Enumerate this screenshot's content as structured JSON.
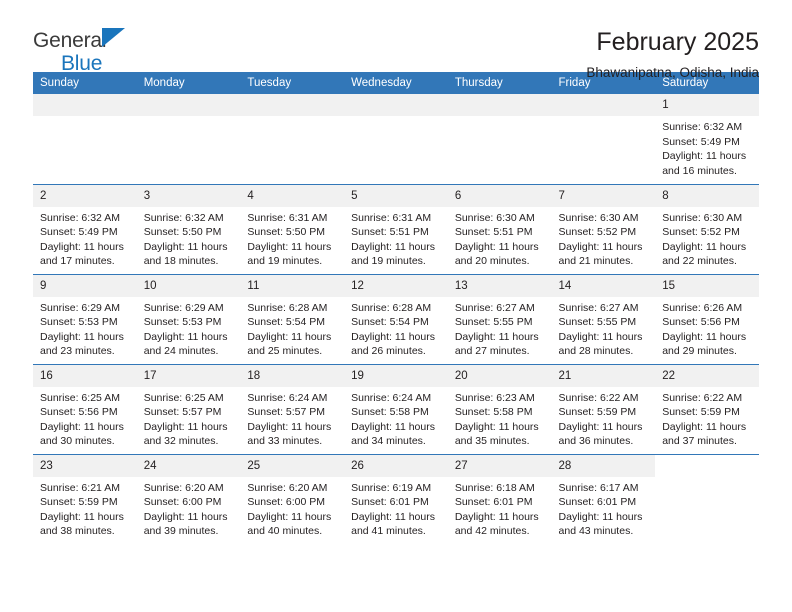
{
  "brand": {
    "line1": "General",
    "line2": "Blue",
    "accent_color": "#1a75bc"
  },
  "header": {
    "title": "February 2025",
    "subtitle": "Bhawanipatna, Odisha, India",
    "header_bg_color": "#3277b8",
    "daynum_bg_color": "#f1f1f1"
  },
  "weekdays": [
    "Sunday",
    "Monday",
    "Tuesday",
    "Wednesday",
    "Thursday",
    "Friday",
    "Saturday"
  ],
  "weeks": [
    [
      {
        "day": "",
        "lines": [],
        "blank": false
      },
      {
        "day": "",
        "lines": [],
        "blank": false
      },
      {
        "day": "",
        "lines": [],
        "blank": false
      },
      {
        "day": "",
        "lines": [],
        "blank": false
      },
      {
        "day": "",
        "lines": [],
        "blank": false
      },
      {
        "day": "",
        "lines": [],
        "blank": false
      },
      {
        "day": "1",
        "lines": [
          "Sunrise: 6:32 AM",
          "Sunset: 5:49 PM",
          "Daylight: 11 hours",
          "and 16 minutes."
        ],
        "blank": false
      }
    ],
    [
      {
        "day": "2",
        "lines": [
          "Sunrise: 6:32 AM",
          "Sunset: 5:49 PM",
          "Daylight: 11 hours",
          "and 17 minutes."
        ],
        "blank": false
      },
      {
        "day": "3",
        "lines": [
          "Sunrise: 6:32 AM",
          "Sunset: 5:50 PM",
          "Daylight: 11 hours",
          "and 18 minutes."
        ],
        "blank": false
      },
      {
        "day": "4",
        "lines": [
          "Sunrise: 6:31 AM",
          "Sunset: 5:50 PM",
          "Daylight: 11 hours",
          "and 19 minutes."
        ],
        "blank": false
      },
      {
        "day": "5",
        "lines": [
          "Sunrise: 6:31 AM",
          "Sunset: 5:51 PM",
          "Daylight: 11 hours",
          "and 19 minutes."
        ],
        "blank": false
      },
      {
        "day": "6",
        "lines": [
          "Sunrise: 6:30 AM",
          "Sunset: 5:51 PM",
          "Daylight: 11 hours",
          "and 20 minutes."
        ],
        "blank": false
      },
      {
        "day": "7",
        "lines": [
          "Sunrise: 6:30 AM",
          "Sunset: 5:52 PM",
          "Daylight: 11 hours",
          "and 21 minutes."
        ],
        "blank": false
      },
      {
        "day": "8",
        "lines": [
          "Sunrise: 6:30 AM",
          "Sunset: 5:52 PM",
          "Daylight: 11 hours",
          "and 22 minutes."
        ],
        "blank": false
      }
    ],
    [
      {
        "day": "9",
        "lines": [
          "Sunrise: 6:29 AM",
          "Sunset: 5:53 PM",
          "Daylight: 11 hours",
          "and 23 minutes."
        ],
        "blank": false
      },
      {
        "day": "10",
        "lines": [
          "Sunrise: 6:29 AM",
          "Sunset: 5:53 PM",
          "Daylight: 11 hours",
          "and 24 minutes."
        ],
        "blank": false
      },
      {
        "day": "11",
        "lines": [
          "Sunrise: 6:28 AM",
          "Sunset: 5:54 PM",
          "Daylight: 11 hours",
          "and 25 minutes."
        ],
        "blank": false
      },
      {
        "day": "12",
        "lines": [
          "Sunrise: 6:28 AM",
          "Sunset: 5:54 PM",
          "Daylight: 11 hours",
          "and 26 minutes."
        ],
        "blank": false
      },
      {
        "day": "13",
        "lines": [
          "Sunrise: 6:27 AM",
          "Sunset: 5:55 PM",
          "Daylight: 11 hours",
          "and 27 minutes."
        ],
        "blank": false
      },
      {
        "day": "14",
        "lines": [
          "Sunrise: 6:27 AM",
          "Sunset: 5:55 PM",
          "Daylight: 11 hours",
          "and 28 minutes."
        ],
        "blank": false
      },
      {
        "day": "15",
        "lines": [
          "Sunrise: 6:26 AM",
          "Sunset: 5:56 PM",
          "Daylight: 11 hours",
          "and 29 minutes."
        ],
        "blank": false
      }
    ],
    [
      {
        "day": "16",
        "lines": [
          "Sunrise: 6:25 AM",
          "Sunset: 5:56 PM",
          "Daylight: 11 hours",
          "and 30 minutes."
        ],
        "blank": false
      },
      {
        "day": "17",
        "lines": [
          "Sunrise: 6:25 AM",
          "Sunset: 5:57 PM",
          "Daylight: 11 hours",
          "and 32 minutes."
        ],
        "blank": false
      },
      {
        "day": "18",
        "lines": [
          "Sunrise: 6:24 AM",
          "Sunset: 5:57 PM",
          "Daylight: 11 hours",
          "and 33 minutes."
        ],
        "blank": false
      },
      {
        "day": "19",
        "lines": [
          "Sunrise: 6:24 AM",
          "Sunset: 5:58 PM",
          "Daylight: 11 hours",
          "and 34 minutes."
        ],
        "blank": false
      },
      {
        "day": "20",
        "lines": [
          "Sunrise: 6:23 AM",
          "Sunset: 5:58 PM",
          "Daylight: 11 hours",
          "and 35 minutes."
        ],
        "blank": false
      },
      {
        "day": "21",
        "lines": [
          "Sunrise: 6:22 AM",
          "Sunset: 5:59 PM",
          "Daylight: 11 hours",
          "and 36 minutes."
        ],
        "blank": false
      },
      {
        "day": "22",
        "lines": [
          "Sunrise: 6:22 AM",
          "Sunset: 5:59 PM",
          "Daylight: 11 hours",
          "and 37 minutes."
        ],
        "blank": false
      }
    ],
    [
      {
        "day": "23",
        "lines": [
          "Sunrise: 6:21 AM",
          "Sunset: 5:59 PM",
          "Daylight: 11 hours",
          "and 38 minutes."
        ],
        "blank": false
      },
      {
        "day": "24",
        "lines": [
          "Sunrise: 6:20 AM",
          "Sunset: 6:00 PM",
          "Daylight: 11 hours",
          "and 39 minutes."
        ],
        "blank": false
      },
      {
        "day": "25",
        "lines": [
          "Sunrise: 6:20 AM",
          "Sunset: 6:00 PM",
          "Daylight: 11 hours",
          "and 40 minutes."
        ],
        "blank": false
      },
      {
        "day": "26",
        "lines": [
          "Sunrise: 6:19 AM",
          "Sunset: 6:01 PM",
          "Daylight: 11 hours",
          "and 41 minutes."
        ],
        "blank": false
      },
      {
        "day": "27",
        "lines": [
          "Sunrise: 6:18 AM",
          "Sunset: 6:01 PM",
          "Daylight: 11 hours",
          "and 42 minutes."
        ],
        "blank": false
      },
      {
        "day": "28",
        "lines": [
          "Sunrise: 6:17 AM",
          "Sunset: 6:01 PM",
          "Daylight: 11 hours",
          "and 43 minutes."
        ],
        "blank": false
      },
      {
        "day": "",
        "lines": [],
        "blank": true
      }
    ]
  ]
}
